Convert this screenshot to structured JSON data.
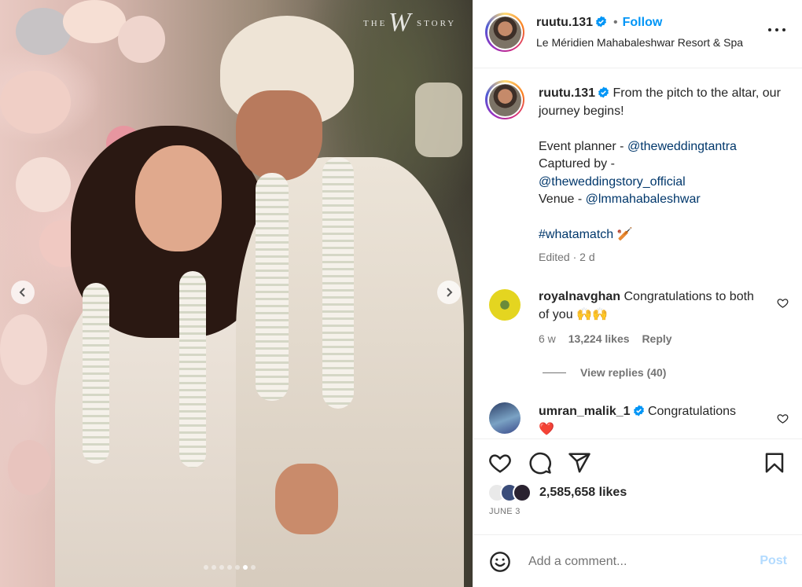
{
  "media": {
    "watermark": {
      "the": "THE",
      "w": "W",
      "story": "STORY"
    },
    "slide_count": 7,
    "active_slide": 6
  },
  "header": {
    "username": "ruutu.131",
    "separator": "•",
    "follow_label": "Follow",
    "location": "Le Méridien Mahabaleshwar Resort & Spa"
  },
  "caption": {
    "username": "ruutu.131",
    "text_lines": [
      "From the pitch to the altar, our journey begins!"
    ],
    "planner_label": "Event planner - ",
    "planner_handle": "@theweddingtantra",
    "captured_label": "Captured by -",
    "captured_handle": "@theweddingstory_official",
    "venue_label": "Venue - ",
    "venue_handle": "@lmmahabaleshwar",
    "hashtag": "#whatamatch",
    "emoji": "🏏",
    "meta": "Edited · 2 d"
  },
  "comments": [
    {
      "username": "royalnavghan",
      "text": "Congratulations to both of you 🙌🙌",
      "time": "6 w",
      "likes": "13,224 likes",
      "reply": "Reply"
    },
    {
      "username": "umran_malik_1",
      "text": "Congratulations",
      "emoji": "❤️"
    }
  ],
  "view_replies": "View replies (40)",
  "actions": {
    "likes": "2,585,658 likes",
    "date": "JUNE 3"
  },
  "comment_box": {
    "placeholder": "Add a comment...",
    "post_label": "Post"
  },
  "icons": {
    "verified": "verified-badge-icon",
    "like": "heart-icon",
    "comment": "comment-bubble-icon",
    "share": "paper-plane-icon",
    "save": "bookmark-icon",
    "emoji": "smiley-icon"
  },
  "colors": {
    "link": "#00376b",
    "follow": "#0095f6",
    "verified": "#0095f6",
    "post_disabled": "#b3dbff",
    "heart_red": "#ed4956"
  }
}
